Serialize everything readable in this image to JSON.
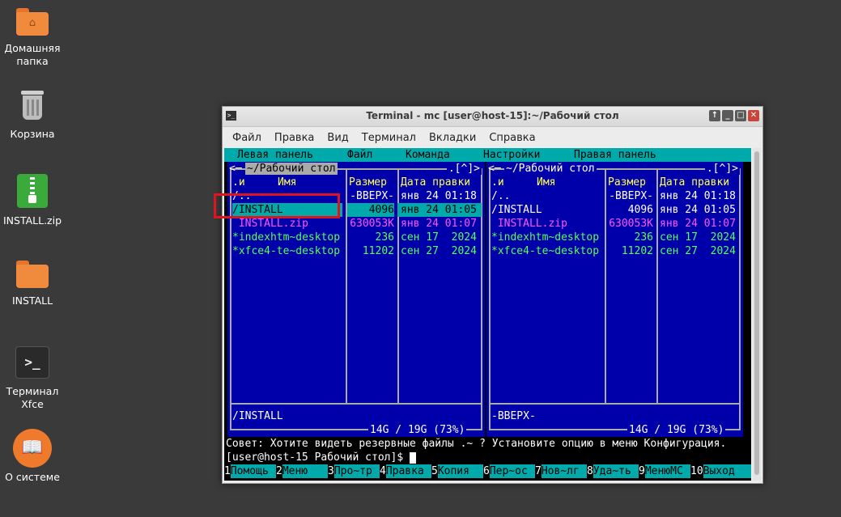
{
  "desktop": {
    "icons": [
      {
        "label": "Домашняя папка",
        "icon": "home-folder-icon"
      },
      {
        "label": "Корзина",
        "icon": "trash-icon"
      },
      {
        "label": "INSTALL.zip",
        "icon": "zip-archive-icon"
      },
      {
        "label": "INSTALL",
        "icon": "folder-icon"
      },
      {
        "label": "Терминал Xfce",
        "icon": "terminal-icon"
      },
      {
        "label": "О системе",
        "icon": "about-system-icon"
      }
    ]
  },
  "window": {
    "title": "Terminal - mc [user@host-15]:~/Рабочий стол",
    "buttons": {
      "raise": "↑",
      "minimize": "_",
      "maximize": "□",
      "close": "✕"
    },
    "menu": [
      "Файл",
      "Правка",
      "Вид",
      "Терминал",
      "Вкладки",
      "Справка"
    ]
  },
  "mc": {
    "menubar": [
      "Левая панель",
      "Файл",
      "Команда",
      "Настройки",
      "Правая панель"
    ],
    "left_panel": {
      "path": "~/Рабочий стол",
      "corner": ".[^]>",
      "left_arrow": "<─",
      "headers": {
        "name_prefix": ".и",
        "name": "Имя",
        "size": "Размер",
        "date": "Дата правки"
      },
      "rows": [
        {
          "name": "/..",
          "size": "-ВВЕРХ-",
          "date": "янв 24 01:18",
          "style": "white"
        },
        {
          "name": "/INSTALL",
          "size": "4096",
          "date": "янв 24 01:05",
          "style": "selected"
        },
        {
          "name": " INSTALL.zip",
          "size": "630053K",
          "date": "янв 24 01:07",
          "style": "magenta"
        },
        {
          "name": "*indexhtm~desktop",
          "size": "236",
          "date": "сен 17  2024",
          "style": "green"
        },
        {
          "name": "*xfce4-te~desktop",
          "size": "11202",
          "date": "сен 27  2024",
          "style": "green"
        }
      ],
      "status": "/INSTALL",
      "disk": "14G / 19G (73%)"
    },
    "right_panel": {
      "path": "~/Рабочий стол",
      "corner": ".[^]>",
      "left_arrow": "<─",
      "headers": {
        "name_prefix": ".и",
        "name": "Имя",
        "size": "Размер",
        "date": "Дата правки"
      },
      "rows": [
        {
          "name": "/..",
          "size": "-ВВЕРХ-",
          "date": "янв 24 01:18",
          "style": "white"
        },
        {
          "name": "/INSTALL",
          "size": "4096",
          "date": "янв 24 01:05",
          "style": "white"
        },
        {
          "name": " INSTALL.zip",
          "size": "630053K",
          "date": "янв 24 01:07",
          "style": "magenta"
        },
        {
          "name": "*indexhtm~desktop",
          "size": "236",
          "date": "сен 17  2024",
          "style": "green"
        },
        {
          "name": "*xfce4-te~desktop",
          "size": "11202",
          "date": "сен 27  2024",
          "style": "green"
        }
      ],
      "status": "-ВВЕРХ-",
      "disk": "14G / 19G (73%)"
    },
    "hint": "Совет: Хотите видеть резервные файлы .~ ? Установите опцию в меню Конфигурация.",
    "prompt": "[user@host-15 Рабочий стол]$ ",
    "fkeys": [
      {
        "n": "1",
        "label": "Помощь"
      },
      {
        "n": "2",
        "label": "Меню"
      },
      {
        "n": "3",
        "label": "Про~тр"
      },
      {
        "n": "4",
        "label": "Правка"
      },
      {
        "n": "5",
        "label": "Копия"
      },
      {
        "n": "6",
        "label": "Пер~ос"
      },
      {
        "n": "7",
        "label": "Нов~лг"
      },
      {
        "n": "8",
        "label": "Уда~ть"
      },
      {
        "n": "9",
        "label": "МенюMC"
      },
      {
        "n": "10",
        "label": "Выход"
      }
    ]
  },
  "colors": {
    "panel_bg": "#0000aa",
    "selection": "#00aaaa",
    "highlight_box": "#e0141e"
  }
}
